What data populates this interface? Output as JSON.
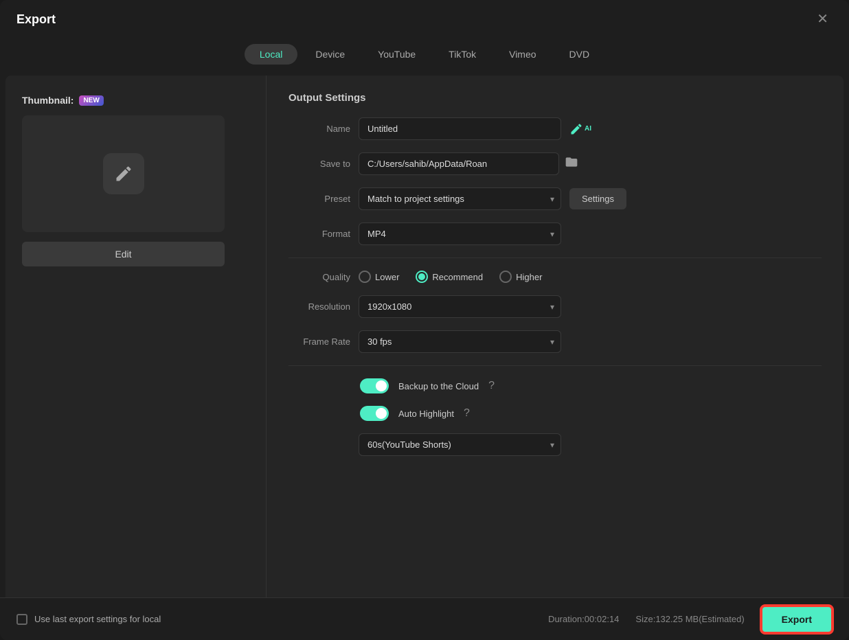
{
  "dialog": {
    "title": "Export",
    "close_label": "✕"
  },
  "tabs": [
    {
      "id": "local",
      "label": "Local",
      "active": true
    },
    {
      "id": "device",
      "label": "Device",
      "active": false
    },
    {
      "id": "youtube",
      "label": "YouTube",
      "active": false
    },
    {
      "id": "tiktok",
      "label": "TikTok",
      "active": false
    },
    {
      "id": "vimeo",
      "label": "Vimeo",
      "active": false
    },
    {
      "id": "dvd",
      "label": "DVD",
      "active": false
    }
  ],
  "thumbnail": {
    "label": "Thumbnail:",
    "badge": "NEW",
    "edit_button": "Edit"
  },
  "output_settings": {
    "title": "Output Settings",
    "name_label": "Name",
    "name_value": "Untitled",
    "save_to_label": "Save to",
    "save_to_value": "C:/Users/sahib/AppData/Roan",
    "preset_label": "Preset",
    "preset_value": "Match to project settings",
    "settings_button": "Settings",
    "format_label": "Format",
    "format_value": "MP4",
    "quality_label": "Quality",
    "quality_options": [
      {
        "id": "lower",
        "label": "Lower",
        "checked": false
      },
      {
        "id": "recommend",
        "label": "Recommend",
        "checked": true
      },
      {
        "id": "higher",
        "label": "Higher",
        "checked": false
      }
    ],
    "resolution_label": "Resolution",
    "resolution_value": "1920x1080",
    "frame_rate_label": "Frame Rate",
    "frame_rate_value": "30 fps",
    "backup_label": "Backup to the Cloud",
    "backup_on": true,
    "auto_highlight_label": "Auto Highlight",
    "auto_highlight_on": true,
    "highlight_duration": "60s(YouTube Shorts)"
  },
  "bottom_bar": {
    "last_export_label": "Use last export settings for local",
    "duration_label": "Duration:00:02:14",
    "size_label": "Size:132.25 MB(Estimated)",
    "export_button": "Export"
  }
}
